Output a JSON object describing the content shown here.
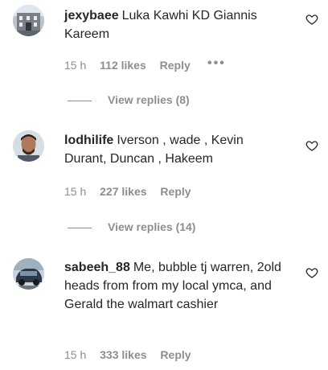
{
  "comments": [
    {
      "username": "jexybaee",
      "text": "Luka Kawhi KD Giannis Kareem",
      "time": "15 h",
      "likes": "112 likes",
      "reply": "Reply",
      "more": "•••",
      "view_replies": "View replies (8)",
      "avatar_icon": "avatar-photo-building"
    },
    {
      "username": "lodhilife",
      "text": "Iverson , wade , Kevin Durant, Duncan , Hakeem",
      "time": "15 h",
      "likes": "227 likes",
      "reply": "Reply",
      "view_replies": "View replies (14)",
      "avatar_icon": "avatar-photo-man"
    },
    {
      "username": "sabeeh_88",
      "text": "Me, bubble tj warren, 2old heads from from my local ymca, and Gerald the walmart cashier",
      "time": "15 h",
      "likes": "333 likes",
      "reply": "Reply",
      "avatar_icon": "avatar-photo-car"
    }
  ],
  "colors": {
    "text": "#262626",
    "secondary": "#8e8e8e",
    "background": "#ffffff"
  }
}
